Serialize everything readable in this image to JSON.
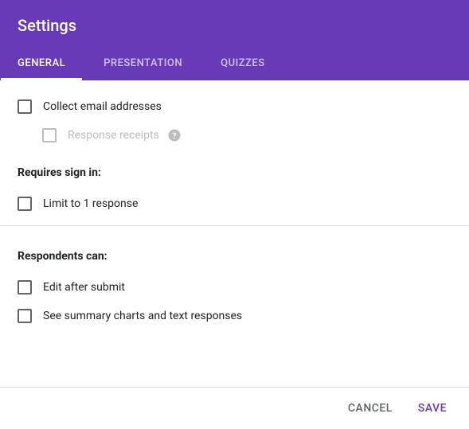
{
  "title": "Settings",
  "tabs": {
    "general": "GENERAL",
    "presentation": "PRESENTATION",
    "quizzes": "QUIZZES"
  },
  "options": {
    "collect_email": "Collect email addresses",
    "response_receipts": "Response receipts",
    "limit_response": "Limit to 1 response",
    "edit_after_submit": "Edit after submit",
    "see_summary": "See summary charts and text responses"
  },
  "sections": {
    "requires_signin": "Requires sign in:",
    "respondents_can": "Respondents can:"
  },
  "footer": {
    "cancel": "CANCEL",
    "save": "SAVE"
  }
}
